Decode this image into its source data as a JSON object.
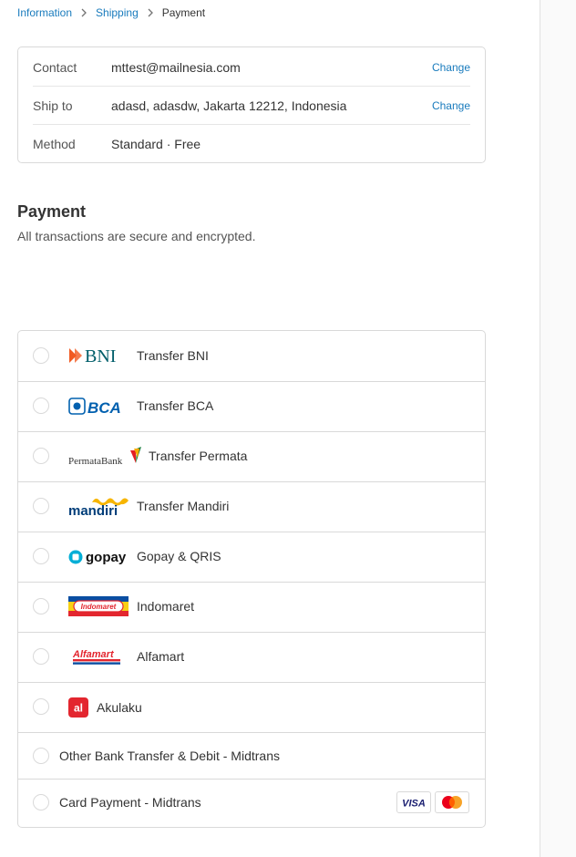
{
  "breadcrumb": {
    "items": [
      {
        "label": "Information"
      },
      {
        "label": "Shipping"
      },
      {
        "label": "Payment"
      }
    ]
  },
  "review": {
    "contact": {
      "label": "Contact",
      "value": "mttest@mailnesia.com",
      "action": "Change"
    },
    "ship_to": {
      "label": "Ship to",
      "value": "adasd, adasdw, Jakarta 12212, Indonesia",
      "action": "Change"
    },
    "method": {
      "label": "Method",
      "value": "Standard · Free"
    }
  },
  "payment": {
    "title": "Payment",
    "subtitle": "All transactions are secure and encrypted.",
    "options": [
      {
        "label": "Transfer BNI",
        "logo_text": "BNI",
        "logo": "bni-logo"
      },
      {
        "label": "Transfer BCA",
        "logo_text": "BCA",
        "logo": "bca-logo"
      },
      {
        "label": "Transfer Permata",
        "logo_text": "PermataBank",
        "logo": "permata-logo"
      },
      {
        "label": "Transfer Mandiri",
        "logo_text": "mandiri",
        "logo": "mandiri-logo"
      },
      {
        "label": "Gopay & QRIS",
        "logo_text": "gopay",
        "logo": "gopay-logo"
      },
      {
        "label": "Indomaret",
        "logo_text": "Indomaret",
        "logo": "indomaret-logo"
      },
      {
        "label": "Alfamart",
        "logo_text": "Alfamart",
        "logo": "alfamart-logo"
      },
      {
        "label": "Akulaku",
        "logo_text": "al",
        "logo": "akulaku-logo"
      },
      {
        "label": "Other Bank Transfer & Debit - Midtrans"
      },
      {
        "label": "Card Payment - Midtrans",
        "card_brands": [
          "VISA",
          "mastercard"
        ]
      }
    ]
  },
  "colors": {
    "link": "#197bbd",
    "border": "#d9d9d9",
    "text": "#333333",
    "muted": "#545454"
  }
}
